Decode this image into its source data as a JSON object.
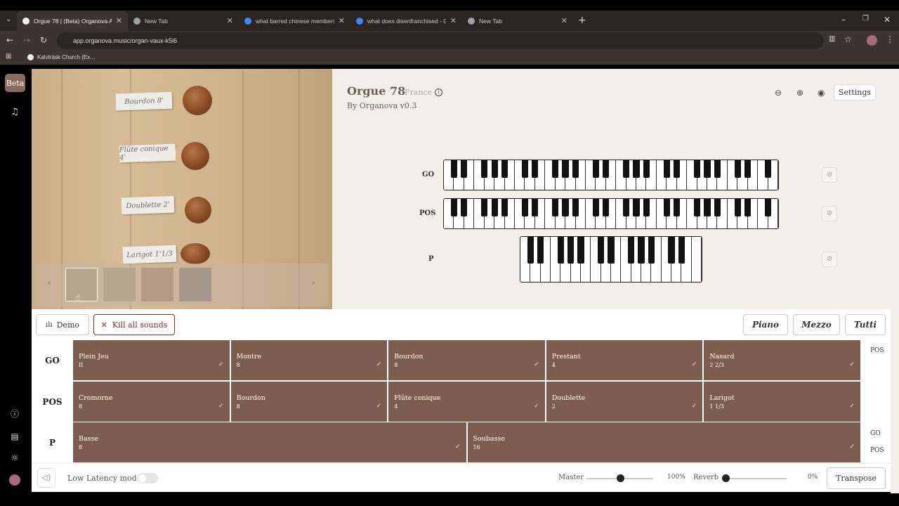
{
  "browser": {
    "tabs": [
      {
        "label": "Orgue 78 | (Beta) Organova Ap…",
        "color": "#f0f0f0"
      },
      {
        "label": "New Tab",
        "color": "#9aa0a6"
      },
      {
        "label": "what barred chinese members…",
        "color": "#4285f4"
      },
      {
        "label": "what does disenfranchised - Go…",
        "color": "#4285f4"
      },
      {
        "label": "New Tab",
        "color": "#9aa0a6"
      }
    ],
    "url": "app.organova.music/organ-vaux-k5l6",
    "bookmark": "Kalvträsk Church (Ex…"
  },
  "sidebar": {
    "beta_label": "Beta"
  },
  "photo": {
    "labels": [
      "Bourdon 8'",
      "Flûte conique 4'",
      "Doublette 2'",
      "Larigot 1'1/3"
    ]
  },
  "organ": {
    "title": "Orgue 78",
    "country": "France",
    "by": "By Organova v0.3",
    "settings_label": "Settings",
    "keyboards": [
      {
        "label": "GO",
        "white_keys": 33
      },
      {
        "label": "POS",
        "white_keys": 33
      },
      {
        "label": "P",
        "white_keys": 18
      }
    ]
  },
  "controls": {
    "demo": "Demo",
    "kill": "Kill all sounds",
    "presets": [
      "Piano",
      "Mezzo",
      "Tutti"
    ]
  },
  "divisions": [
    {
      "name": "GO",
      "couplers": [
        "POS"
      ],
      "stops": [
        {
          "name": "Plein Jeu",
          "foot": "II"
        },
        {
          "name": "Montre",
          "foot": "8"
        },
        {
          "name": "Bourdon",
          "foot": "8"
        },
        {
          "name": "Prestant",
          "foot": "4"
        },
        {
          "name": "Nasard",
          "foot": "2 2/3"
        }
      ]
    },
    {
      "name": "POS",
      "couplers": [],
      "stops": [
        {
          "name": "Cromorne",
          "foot": "8"
        },
        {
          "name": "Bourdon",
          "foot": "8"
        },
        {
          "name": "Flûte conique",
          "foot": "4"
        },
        {
          "name": "Doublette",
          "foot": "2"
        },
        {
          "name": "Larigot",
          "foot": "1 1/3"
        }
      ]
    },
    {
      "name": "P",
      "couplers": [
        "GO",
        "POS"
      ],
      "stops": [
        {
          "name": "Basse",
          "foot": "8"
        },
        {
          "name": "Soubasse",
          "foot": "16"
        }
      ]
    }
  ],
  "footer": {
    "low_latency": "Low Latency mode",
    "master_label": "Master",
    "master_value": "100%",
    "master_level": 0.5,
    "reverb_label": "Reverb",
    "reverb_value": "0%",
    "reverb_level": 0.0,
    "transpose": "Transpose"
  }
}
